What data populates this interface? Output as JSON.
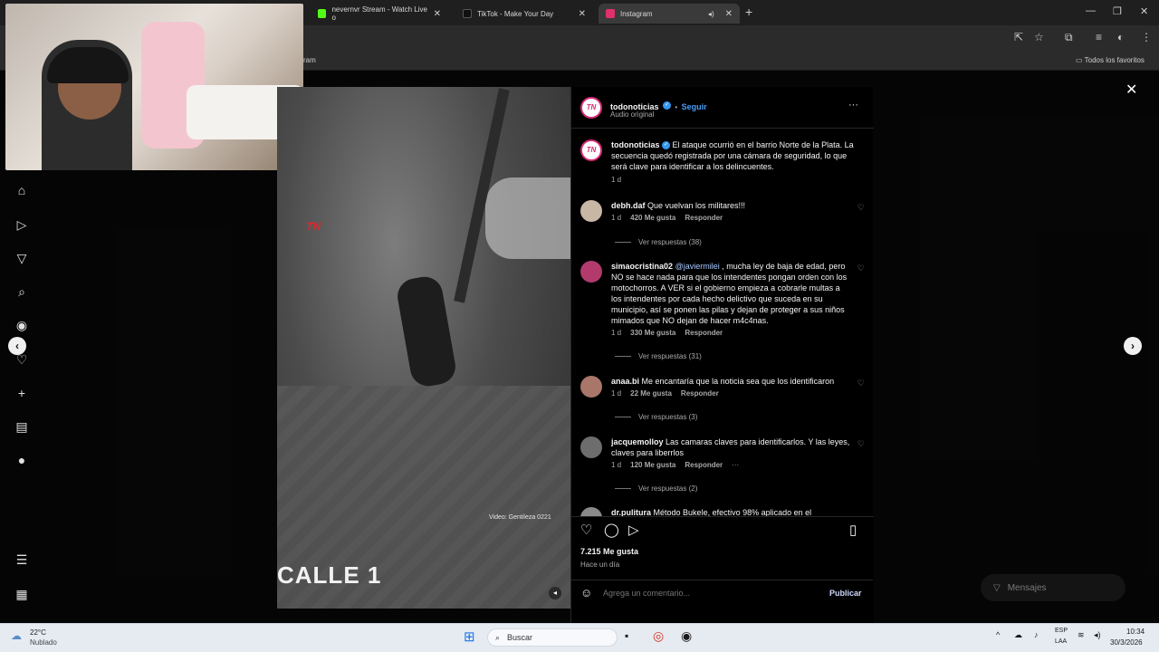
{
  "browser": {
    "tabs": [
      {
        "title": "nevernvr Stream - Watch Live o",
        "color": "#53fc18"
      },
      {
        "title": "TikTok - Make Your Day",
        "color": "#ffffff"
      },
      {
        "title": "Instagram",
        "color": "#e1306c",
        "active": true
      }
    ],
    "new_tab": "+",
    "bookmarks_partial": "ram",
    "bookmarks_all": "Todos los favoritos"
  },
  "post": {
    "author": "todonoticias",
    "follow_label": "Seguir",
    "dot": "•",
    "audio": "Audio original",
    "more": "···",
    "caption_author": "todonoticias",
    "caption": "El ataque ocurrió en el barrio Norte de la Plata. La secuencia quedó registrada por una cámara de seguridad, lo que será clave para identificar a los delincuentes.",
    "caption_time": "1 d",
    "video_logo": "TN",
    "video_credit": "Video: Gentileza 0221",
    "video_banner": "CALLE 1",
    "likes": "7.215 Me gusta",
    "time_ago": "Hace un día",
    "add_comment_placeholder": "Agrega un comentario...",
    "publish": "Publicar"
  },
  "comments": [
    {
      "user": "debh.daf",
      "text": "Que vuelvan los militares!!!",
      "time": "1 d",
      "likes": "420 Me gusta",
      "reply": "Responder",
      "replies": "Ver respuestas (38)"
    },
    {
      "user": "simaocristina02",
      "mention": "@javiermilei",
      "text": ", mucha ley de baja de edad, pero NO se hace nada para que los intendentes pongan orden con los motochorros. A VER si el gobierno empieza a cobrarle multas a los intendentes por cada hecho delictivo que suceda en su municipio, así se ponen las pilas y dejan de proteger a sus niños mimados que NO dejan de hacer m4c4nas.",
      "time": "1 d",
      "likes": "330 Me gusta",
      "reply": "Responder",
      "replies": "Ver respuestas (31)"
    },
    {
      "user": "anaa.bi",
      "text": "Me encantaría que la noticia sea que los identificaron",
      "time": "1 d",
      "likes": "22 Me gusta",
      "reply": "Responder",
      "replies": "Ver respuestas (3)"
    },
    {
      "user": "jacquemolloy",
      "text": "Las camaras claves para identificarlos. Y las leyes, claves para liberrlos",
      "time": "1 d",
      "likes": "120 Me gusta",
      "reply": "Responder",
      "more": "···",
      "replies": "Ver respuestas (2)"
    },
    {
      "user": "dr.pulitura",
      "text": "Método Bukele, efectivo 98% aplicado en el"
    }
  ],
  "messages_label": "Mensajes",
  "taskbar": {
    "weather_temp": "22°C",
    "weather_desc": "Nublado",
    "search": "Buscar",
    "lang1": "ESP",
    "lang2": "LAA",
    "time": "10:34",
    "date": "30/3/2026"
  }
}
